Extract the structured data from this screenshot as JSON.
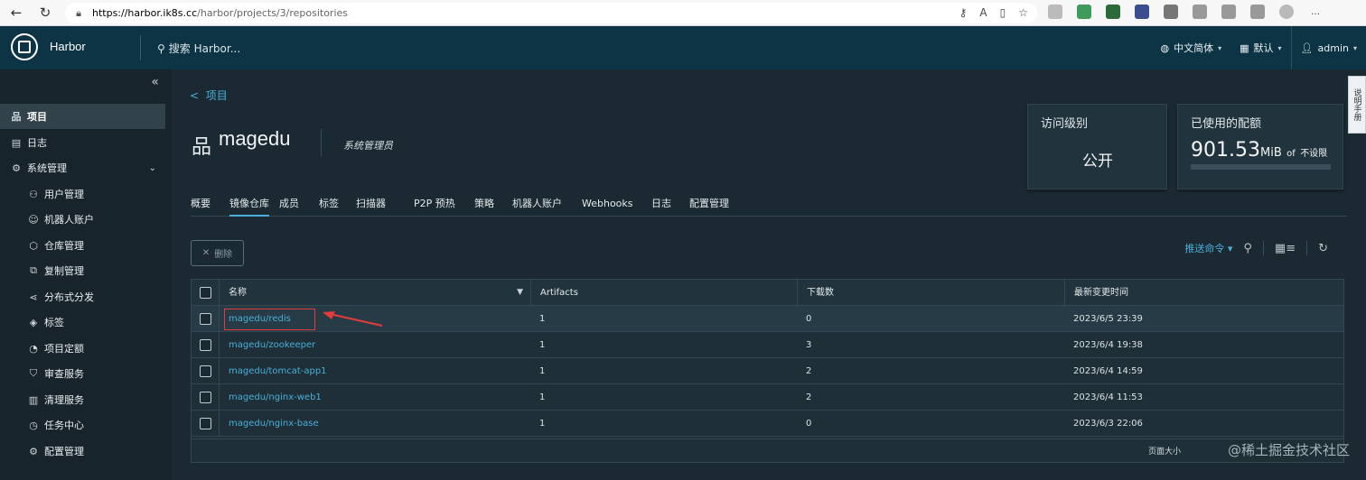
{
  "browser": {
    "url_host": "https://harbor.ik8s.cc",
    "url_path": "/harbor/projects/3/repositories"
  },
  "header": {
    "brand": "Harbor",
    "search_placeholder": "搜索 Harbor...",
    "language": "中文简体",
    "theme": "默认",
    "user": "admin"
  },
  "sidebar": {
    "items": [
      {
        "label": "项目",
        "icon": "project-icon",
        "active": true
      },
      {
        "label": "日志",
        "icon": "log-icon"
      },
      {
        "label": "系统管理",
        "icon": "admin-icon",
        "expanded": true
      },
      {
        "label": "用户管理",
        "icon": "users-icon"
      },
      {
        "label": "机器人账户",
        "icon": "robot-icon"
      },
      {
        "label": "仓库管理",
        "icon": "registry-icon"
      },
      {
        "label": "复制管理",
        "icon": "replication-icon"
      },
      {
        "label": "分布式分发",
        "icon": "share-icon"
      },
      {
        "label": "标签",
        "icon": "tag-icon"
      },
      {
        "label": "项目定额",
        "icon": "quota-icon"
      },
      {
        "label": "审查服务",
        "icon": "shield-icon"
      },
      {
        "label": "清理服务",
        "icon": "trash-icon"
      },
      {
        "label": "任务中心",
        "icon": "clock-icon"
      },
      {
        "label": "配置管理",
        "icon": "gear-icon"
      }
    ]
  },
  "project": {
    "back_label": "项目",
    "name": "magedu",
    "role": "系统管理员"
  },
  "cards": {
    "access_title": "访问级别",
    "access_value": "公开",
    "quota_title": "已使用的配额",
    "quota_value": "901.53",
    "quota_unit": "MiB",
    "quota_of": "of",
    "quota_limit": "不设限"
  },
  "tabs": [
    "概要",
    "镜像仓库",
    "成员",
    "标签",
    "扫描器",
    "P2P 预热",
    "策略",
    "机器人账户",
    "Webhooks",
    "日志",
    "配置管理"
  ],
  "toolbar": {
    "delete_label": "删除",
    "push_command": "推送命令"
  },
  "table": {
    "headers": [
      "名称",
      "Artifacts",
      "下载数",
      "最新变更时间"
    ],
    "rows": [
      {
        "name": "magedu/redis",
        "artifacts": "1",
        "downloads": "0",
        "updated": "2023/6/5 23:39"
      },
      {
        "name": "magedu/zookeeper",
        "artifacts": "1",
        "downloads": "3",
        "updated": "2023/6/4 19:38"
      },
      {
        "name": "magedu/tomcat-app1",
        "artifacts": "1",
        "downloads": "2",
        "updated": "2023/6/4 14:59"
      },
      {
        "name": "magedu/nginx-web1",
        "artifacts": "1",
        "downloads": "2",
        "updated": "2023/6/4 11:53"
      },
      {
        "name": "magedu/nginx-base",
        "artifacts": "1",
        "downloads": "0",
        "updated": "2023/6/3 22:06"
      }
    ],
    "footer": "页面大小"
  },
  "side_tab": "说明手册",
  "watermark": "@稀土掘金技术社区"
}
